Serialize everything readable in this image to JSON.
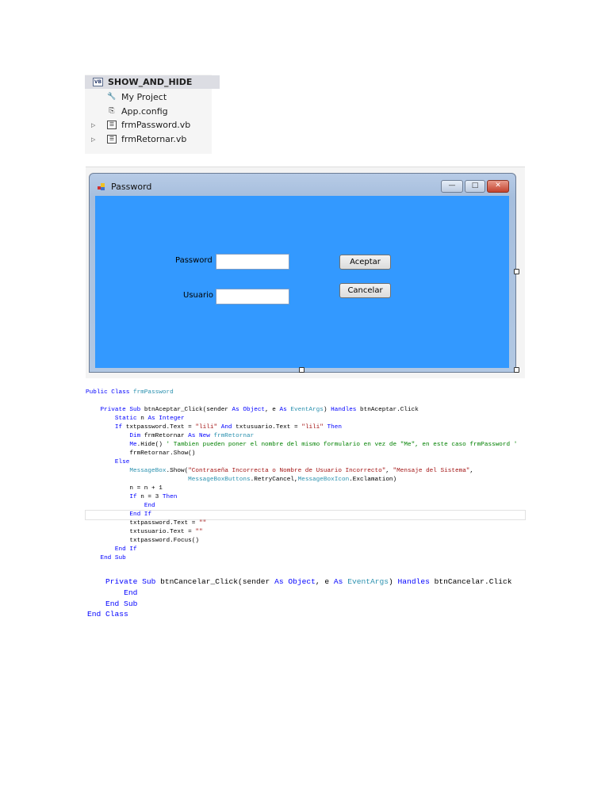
{
  "solution_explorer": {
    "project": "SHOW_AND_HIDE",
    "items": [
      {
        "label": "My Project",
        "icon": "wrench-icon",
        "expandable": false
      },
      {
        "label": "App.config",
        "icon": "config-file-icon",
        "expandable": false
      },
      {
        "label": "frmPassword.vb",
        "icon": "form-file-icon",
        "expandable": true
      },
      {
        "label": "frmRetornar.vb",
        "icon": "form-file-icon",
        "expandable": true
      }
    ]
  },
  "form": {
    "title": "Password",
    "background": "#3399ff",
    "password_label": "Password",
    "usuario_label": "Usuario",
    "password_value": "",
    "usuario_value": "",
    "aceptar_label": "Aceptar",
    "cancelar_label": "Cancelar",
    "minimize": "—",
    "maximize": "□",
    "close": "✕"
  },
  "code_block_1": [
    [
      [
        "kw",
        "Public Class "
      ],
      [
        "ty",
        "frmPassword"
      ]
    ],
    [],
    [
      [
        "tx",
        "    "
      ],
      [
        "kw",
        "Private Sub "
      ],
      [
        "tx",
        "btnAceptar_Click(sender "
      ],
      [
        "kw",
        "As Object"
      ],
      [
        "tx",
        ", e "
      ],
      [
        "kw",
        "As "
      ],
      [
        "ty",
        "EventArgs"
      ],
      [
        "tx",
        ") "
      ],
      [
        "kw",
        "Handles "
      ],
      [
        "tx",
        "btnAceptar.Click"
      ]
    ],
    [
      [
        "tx",
        "        "
      ],
      [
        "kw",
        "Static "
      ],
      [
        "tx",
        "n "
      ],
      [
        "kw",
        "As Integer"
      ]
    ],
    [
      [
        "tx",
        "        "
      ],
      [
        "kw",
        "If "
      ],
      [
        "tx",
        "txtpassword.Text = "
      ],
      [
        "st",
        "\"lili\""
      ],
      [
        "kw",
        " And "
      ],
      [
        "tx",
        "txtusuario.Text = "
      ],
      [
        "st",
        "\"lili\""
      ],
      [
        "kw",
        " Then"
      ]
    ],
    [
      [
        "tx",
        "            "
      ],
      [
        "kw",
        "Dim "
      ],
      [
        "tx",
        "frmRetornar "
      ],
      [
        "kw",
        "As New "
      ],
      [
        "ty",
        "frmRetornar"
      ]
    ],
    [
      [
        "tx",
        "            "
      ],
      [
        "kw",
        "Me"
      ],
      [
        "tx",
        ".Hide() "
      ],
      [
        "cm",
        "' Tambien pueden poner el nombre del mismo formulario en vez de \"Me\", en este caso frmPassword '"
      ]
    ],
    [
      [
        "tx",
        "            frmRetornar.Show()"
      ]
    ],
    [
      [
        "tx",
        "        "
      ],
      [
        "kw",
        "Else"
      ]
    ],
    [
      [
        "tx",
        "            "
      ],
      [
        "ty",
        "MessageBox"
      ],
      [
        "tx",
        ".Show("
      ],
      [
        "st",
        "\"Contraseña Incorrecta o Nombre de Usuario Incorrecto\""
      ],
      [
        "tx",
        ", "
      ],
      [
        "st",
        "\"Mensaje del Sistema\""
      ],
      [
        "tx",
        ","
      ]
    ],
    [
      [
        "tx",
        "                            "
      ],
      [
        "ty",
        "MessageBoxButtons"
      ],
      [
        "tx",
        ".RetryCancel,"
      ],
      [
        "ty",
        "MessageBoxIcon"
      ],
      [
        "tx",
        ".Exclamation)"
      ]
    ],
    [
      [
        "tx",
        "            n = n + 1"
      ]
    ],
    [
      [
        "tx",
        "            "
      ],
      [
        "kw",
        "If "
      ],
      [
        "tx",
        "n = 3 "
      ],
      [
        "kw",
        "Then"
      ]
    ],
    [
      [
        "tx",
        "                "
      ],
      [
        "kw",
        "End"
      ]
    ],
    [
      [
        "tx",
        "            "
      ],
      [
        "kw",
        "End If"
      ]
    ],
    [
      [
        "tx",
        "            txtpassword.Text = "
      ],
      [
        "st",
        "\"\""
      ]
    ],
    [
      [
        "tx",
        "            txtusuario.Text = "
      ],
      [
        "st",
        "\"\""
      ]
    ],
    [
      [
        "tx",
        "            txtpassword.Focus()"
      ]
    ],
    [
      [
        "tx",
        "        "
      ],
      [
        "kw",
        "End If"
      ]
    ],
    [
      [
        "tx",
        "    "
      ],
      [
        "kw",
        "End Sub"
      ]
    ]
  ],
  "code_block_2": [
    [
      [
        "tx",
        "    "
      ],
      [
        "kw",
        "Private Sub "
      ],
      [
        "tx",
        "btnCancelar_Click(sender "
      ],
      [
        "kw",
        "As Object"
      ],
      [
        "tx",
        ", e "
      ],
      [
        "kw",
        "As "
      ],
      [
        "ty",
        "EventArgs"
      ],
      [
        "tx",
        ") "
      ],
      [
        "kw",
        "Handles "
      ],
      [
        "tx",
        "btnCancelar.Click"
      ]
    ],
    [
      [
        "tx",
        "        "
      ],
      [
        "kw",
        "End"
      ]
    ],
    [
      [
        "tx",
        "    "
      ],
      [
        "kw",
        "End Sub"
      ]
    ],
    [
      [
        "kw",
        "End Class"
      ]
    ]
  ]
}
